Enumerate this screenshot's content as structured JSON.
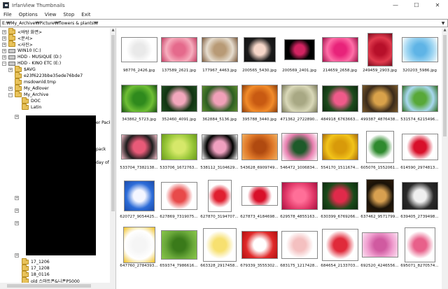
{
  "window": {
    "title": "IrfanView Thumbnails",
    "minimize": "—",
    "maximize": "☐",
    "close": "✕"
  },
  "menu": [
    "File",
    "Options",
    "View",
    "Stop",
    "Exit"
  ],
  "path": "E:₩My_Archive₩Picture₩flowers & plants₩",
  "tree": [
    {
      "label": "<바탕 화면>",
      "icon": "folder-icon"
    },
    {
      "label": "<문서>",
      "icon": "folder-icon"
    },
    {
      "label": "<사진>",
      "icon": "folder-icon"
    },
    {
      "label": "WIN10 (C:)",
      "icon": "drive-icon"
    },
    {
      "label": "HDD - MUSIQUE (D:)",
      "icon": "drive-icon"
    },
    {
      "label": "HDD - KINO ETC (E:)",
      "icon": "drive-icon"
    },
    {
      "label": "$AVG",
      "icon": "folder-icon"
    },
    {
      "label": "e23f6223bbe35ede76bde7",
      "icon": "folder-icon"
    },
    {
      "label": "msdownld.tmp",
      "icon": "folder-icon"
    },
    {
      "label": "My_Adlover",
      "icon": "folder-icon"
    },
    {
      "label": "My_Archive",
      "icon": "folder-icon"
    },
    {
      "label": "DOC",
      "icon": "folder-icon"
    },
    {
      "label": "Latin",
      "icon": "folder-icon"
    },
    {
      "label": "17_1206",
      "icon": "folder-icon"
    },
    {
      "label": "17_1208",
      "icon": "folder-icon"
    },
    {
      "label": "18_0116",
      "icon": "folder-icon"
    },
    {
      "label": "old 스마트폰&니폰P5000",
      "icon": "folder-icon"
    }
  ],
  "tree_partial_text": [
    "er Pack",
    "pack",
    "day of p"
  ],
  "thumbnails": [
    {
      "caption": "98776_2426.jpg",
      "colors": [
        "#ffffff",
        "#e9e9e9",
        "#ffffff"
      ]
    },
    {
      "caption": "137589_2621.jpg",
      "colors": [
        "#f7aebe",
        "#e56a8c",
        "#c23c62"
      ]
    },
    {
      "caption": "177967_4463.jpg",
      "colors": [
        "#e6ddcf",
        "#b89a76",
        "#7b5a3c"
      ]
    },
    {
      "caption": "200565_5430.jpg",
      "colors": [
        "#1b1b1b",
        "#f5d6c8",
        "#111111"
      ]
    },
    {
      "caption": "200569_2401.jpg",
      "colors": [
        "#000000",
        "#d12361",
        "#000000"
      ]
    },
    {
      "caption": "214659_2658.jpg",
      "colors": [
        "#ff6fa8",
        "#e8237a",
        "#9d1248"
      ]
    },
    {
      "caption": "249459_2903.jpg",
      "colors": [
        "#e03a4d",
        "#b7102a",
        "#7a0a1c"
      ]
    },
    {
      "caption": "320203_5986.jpg",
      "colors": [
        "#9fd6f2",
        "#5fb4e6",
        "#ffffff"
      ]
    },
    {
      "caption": "343862_5723.jpg",
      "colors": [
        "#6fbf35",
        "#2f8a1d",
        "#154d0f"
      ]
    },
    {
      "caption": "352460_4091.jpg",
      "colors": [
        "#113311",
        "#f2a7bc",
        "#1f4d1f"
      ]
    },
    {
      "caption": "362884_5136.jpg",
      "colors": [
        "#2d5d22",
        "#f0a0b8",
        "#5d8d2f"
      ]
    },
    {
      "caption": "395788_3440.jpg",
      "colors": [
        "#f28c2a",
        "#c85a12",
        "#8a3a08"
      ]
    },
    {
      "caption": "471362_2722890...",
      "colors": [
        "#d9d8b8",
        "#a8a884",
        "#777757"
      ]
    },
    {
      "caption": "484918_6763663...",
      "colors": [
        "#1c4a1c",
        "#ef5a8a",
        "#0e2a0e"
      ]
    },
    {
      "caption": "499387_4876438...",
      "colors": [
        "#3a2a1a",
        "#d9a24a",
        "#7a5a2a"
      ]
    },
    {
      "caption": "531574_6215496...",
      "colors": [
        "#a8d8f0",
        "#58a838",
        "#2c6c1c"
      ]
    },
    {
      "caption": "533704_7382138...",
      "colors": [
        "#1c1c1c",
        "#e85a78",
        "#f7c0cc"
      ]
    },
    {
      "caption": "533706_1672763...",
      "colors": [
        "#9ac83a",
        "#d6e86a",
        "#6a9a1a"
      ]
    },
    {
      "caption": "538112_3104629...",
      "colors": [
        "#000000",
        "#f0a0c0",
        "#ffffff"
      ]
    },
    {
      "caption": "543628_6909749...",
      "colors": [
        "#e07a2a",
        "#b04a10",
        "#f0b060"
      ]
    },
    {
      "caption": "546472_1006834...",
      "colors": [
        "#e880b0",
        "#1e5a2a",
        "#ffffff"
      ]
    },
    {
      "caption": "554170_1511674...",
      "colors": [
        "#f2c41a",
        "#d89a0a",
        "#a86a08"
      ]
    },
    {
      "caption": "605076_1552061...",
      "colors": [
        "#ffffff",
        "#2e8a2e",
        "#ffffff"
      ]
    },
    {
      "caption": "614590_2974813...",
      "colors": [
        "#ffffff",
        "#d8102a",
        "#ffffff"
      ]
    },
    {
      "caption": "620727_9054425...",
      "colors": [
        "#2c6cd8",
        "#f4f6ff",
        "#1a4aa8"
      ]
    },
    {
      "caption": "627869_7319075...",
      "colors": [
        "#ffffff",
        "#e84a4a",
        "#ffffff"
      ]
    },
    {
      "caption": "627870_3194707...",
      "colors": [
        "#ffffff",
        "#e02030",
        "#ffffff"
      ]
    },
    {
      "caption": "627873_4184698...",
      "colors": [
        "#ffffff",
        "#d8102a",
        "#ffffff"
      ]
    },
    {
      "caption": "629578_4855163...",
      "colors": [
        "#e23a6a",
        "#ff6f98",
        "#a81040"
      ]
    },
    {
      "caption": "630399_6769266...",
      "colors": [
        "#1a4a1a",
        "#e02a4a",
        "#0e2a0e"
      ]
    },
    {
      "caption": "637462_9571799...",
      "colors": [
        "#1a1208",
        "#d8a050",
        "#2a1a08"
      ]
    },
    {
      "caption": "639405_2739498...",
      "colors": [
        "#2a2a2a",
        "#f0f0f0",
        "#1a1a1a"
      ]
    },
    {
      "caption": "647760_2784393...",
      "colors": [
        "#ffffff",
        "#f5f5f5",
        "#f0c020"
      ]
    },
    {
      "caption": "659374_7986616...",
      "colors": [
        "#6aa83a",
        "#3a7a1a",
        "#8ac84a"
      ]
    },
    {
      "caption": "663328_2917458...",
      "colors": [
        "#ffffff",
        "#f7e070",
        "#ffffff"
      ]
    },
    {
      "caption": "679339_3555302...",
      "colors": [
        "#e02a2a",
        "#ffffff",
        "#b01010"
      ]
    },
    {
      "caption": "683175_1217428...",
      "colors": [
        "#ffffff",
        "#f4c0c0",
        "#ffffff"
      ]
    },
    {
      "caption": "684654_2133703...",
      "colors": [
        "#ffffff",
        "#e02a3a",
        "#ffffff"
      ]
    },
    {
      "caption": "692520_4246556...",
      "colors": [
        "#f0a0d0",
        "#d05aa0",
        "#fbe0f0"
      ]
    },
    {
      "caption": "695071_8270574...",
      "colors": [
        "#ffffff",
        "#e8608a",
        "#ffffff"
      ]
    }
  ]
}
